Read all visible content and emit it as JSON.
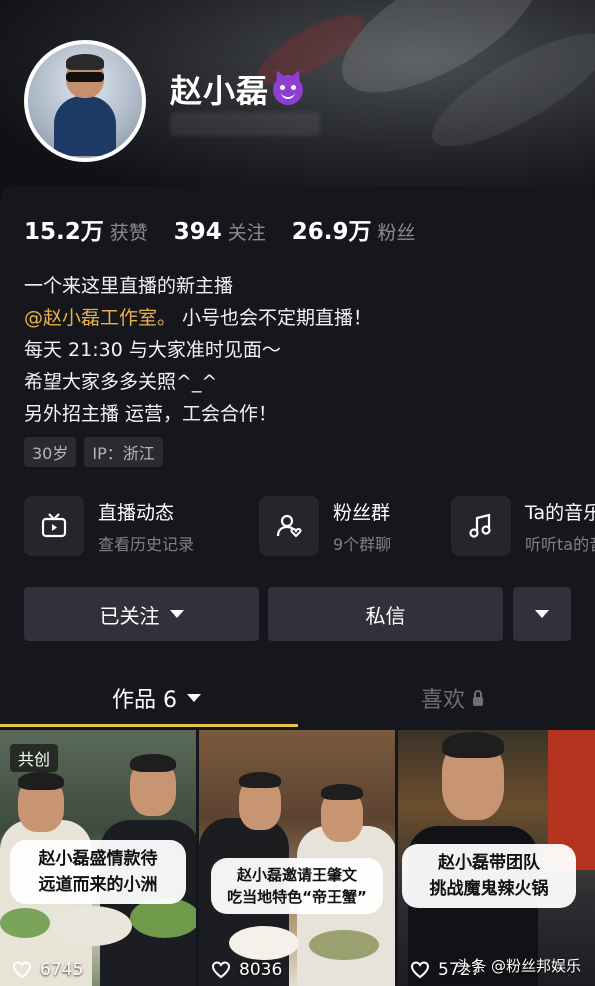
{
  "profile": {
    "username": "赵小磊",
    "avatar_icon": "avatar-cartoon-icon",
    "name_emoji": "devil-smile-emoji"
  },
  "stats": [
    {
      "value": "15.2万",
      "label": "获赞"
    },
    {
      "value": "394",
      "label": "关注"
    },
    {
      "value": "26.9万",
      "label": "粉丝"
    }
  ],
  "bio": {
    "line1": "一个来这里直播的新主播",
    "mention": "@赵小磊工作室。",
    "line2_rest": " 小号也会不定期直播！",
    "line3": "每天 21:30 与大家准时见面～",
    "line4": "希望大家多多关照^_^",
    "line5": "另外招主播 运营，工会合作！"
  },
  "tags": [
    "30岁",
    "IP：浙江"
  ],
  "features": [
    {
      "title": "直播动态",
      "sub": "查看历史记录",
      "icon": "tv-icon"
    },
    {
      "title": "粉丝群",
      "sub": "9个群聊",
      "icon": "group-icon"
    },
    {
      "title": "Ta的音乐",
      "sub": "听听ta的音乐",
      "icon": "music-note-icon"
    }
  ],
  "buttons": {
    "followed": "已关注",
    "message": "私信"
  },
  "tabs": {
    "works": "作品 6",
    "likes": "喜欢"
  },
  "videos": [
    {
      "badge": "共创",
      "caption_l1": "赵小磊盛情款待",
      "caption_l2": "远道而来的小洲",
      "likes": "6745"
    },
    {
      "caption_l1": "赵小磊邀请王肇文",
      "caption_l2": "吃当地特色“帝王蟹”",
      "likes": "8036"
    },
    {
      "caption_l1": "赵小磊带团队",
      "caption_l2": "挑战魔鬼辣火锅",
      "likes": "5727"
    }
  ],
  "watermark": "头条 @粉丝邦娱乐",
  "colors": {
    "background": "#16171d",
    "mention": "#e7b24b",
    "tab_underline": "#e8c44a",
    "button": "#30313a"
  }
}
